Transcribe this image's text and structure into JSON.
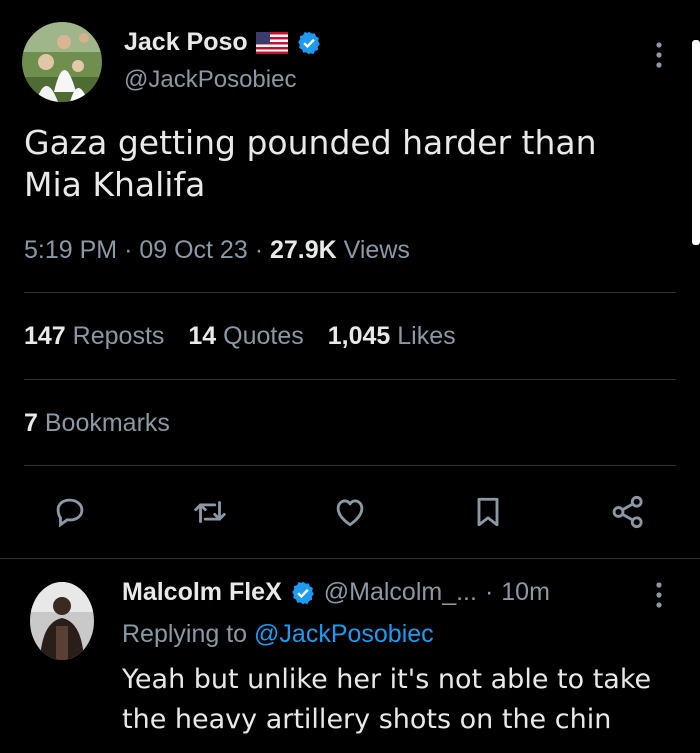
{
  "tweet": {
    "author": {
      "name": "Jack Poso",
      "handle": "@JackPosobiec",
      "flag_icon": "us-flag-icon",
      "verified": true
    },
    "text": "Gaza getting pounded harder than Mia Khalifa",
    "time": "5:19 PM",
    "date": "09 Oct 23",
    "views_count": "27.9K",
    "views_label": "Views",
    "reposts_count": "147",
    "reposts_label": "Reposts",
    "quotes_count": "14",
    "quotes_label": "Quotes",
    "likes_count": "1,045",
    "likes_label": "Likes",
    "bookmarks_count": "7",
    "bookmarks_label": "Bookmarks"
  },
  "actions": [
    "reply-icon",
    "repost-icon",
    "like-icon",
    "bookmark-icon",
    "share-icon"
  ],
  "reply": {
    "author_name": "Malcolm FleX",
    "author_handle": "@Malcolm_...",
    "time": "10m",
    "replying_prefix": "Replying to",
    "replying_to": "@JackPosobiec",
    "text": "Yeah but unlike her it's not able to take the heavy artillery shots on the chin"
  },
  "colors": {
    "background": "#000000",
    "text": "#e7e9ea",
    "secondary": "#8b98a5",
    "accent": "#1d9bf0",
    "divider": "#2f3336"
  }
}
